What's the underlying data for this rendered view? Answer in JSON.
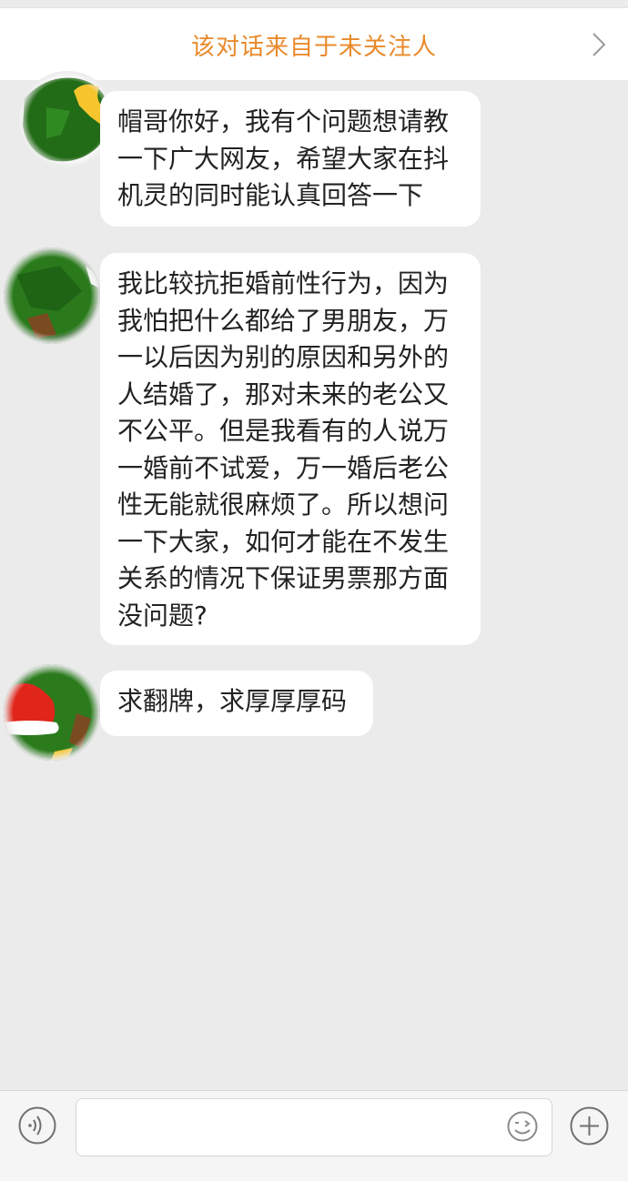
{
  "banner": {
    "text": "该对话来自于未关注人",
    "chevron_icon": "chevron-right-icon"
  },
  "messages": [
    {
      "avatar_icon": "christmas-tree-avatar-icon",
      "text": "帽哥你好，我有个问题想请教\n一下广大网友，希望大家在抖\n机灵的同时能认真回答一下"
    },
    {
      "avatar_icon": "christmas-tree-avatar-icon",
      "text": "我比较抗拒婚前性行为，因为\n我怕把什么都给了男朋友，万\n一以后因为别的原因和另外的\n人结婚了，那对未来的老公又\n不公平。但是我看有的人说万\n一婚前不试爱，万一婚后老公\n性无能就很麻烦了。所以想问\n一下大家，如何才能在不发生\n关系的情况下保证男票那方面\n没问题?"
    },
    {
      "avatar_icon": "christmas-tree-santa-hat-avatar-icon",
      "text": "求翻牌，求厚厚厚码"
    }
  ],
  "composer": {
    "voice_icon": "voice-icon",
    "input_value": "",
    "input_placeholder": "",
    "emoji_icon": "emoji-icon",
    "plus_icon": "plus-icon"
  },
  "colors": {
    "background": "#ebebeb",
    "banner_text": "#e9892b",
    "bubble": "#ffffff",
    "message_text": "#222222",
    "avatar_green": "#1f6a16",
    "avatar_yellow": "#f6c52d",
    "hat_red": "#e0261b"
  }
}
